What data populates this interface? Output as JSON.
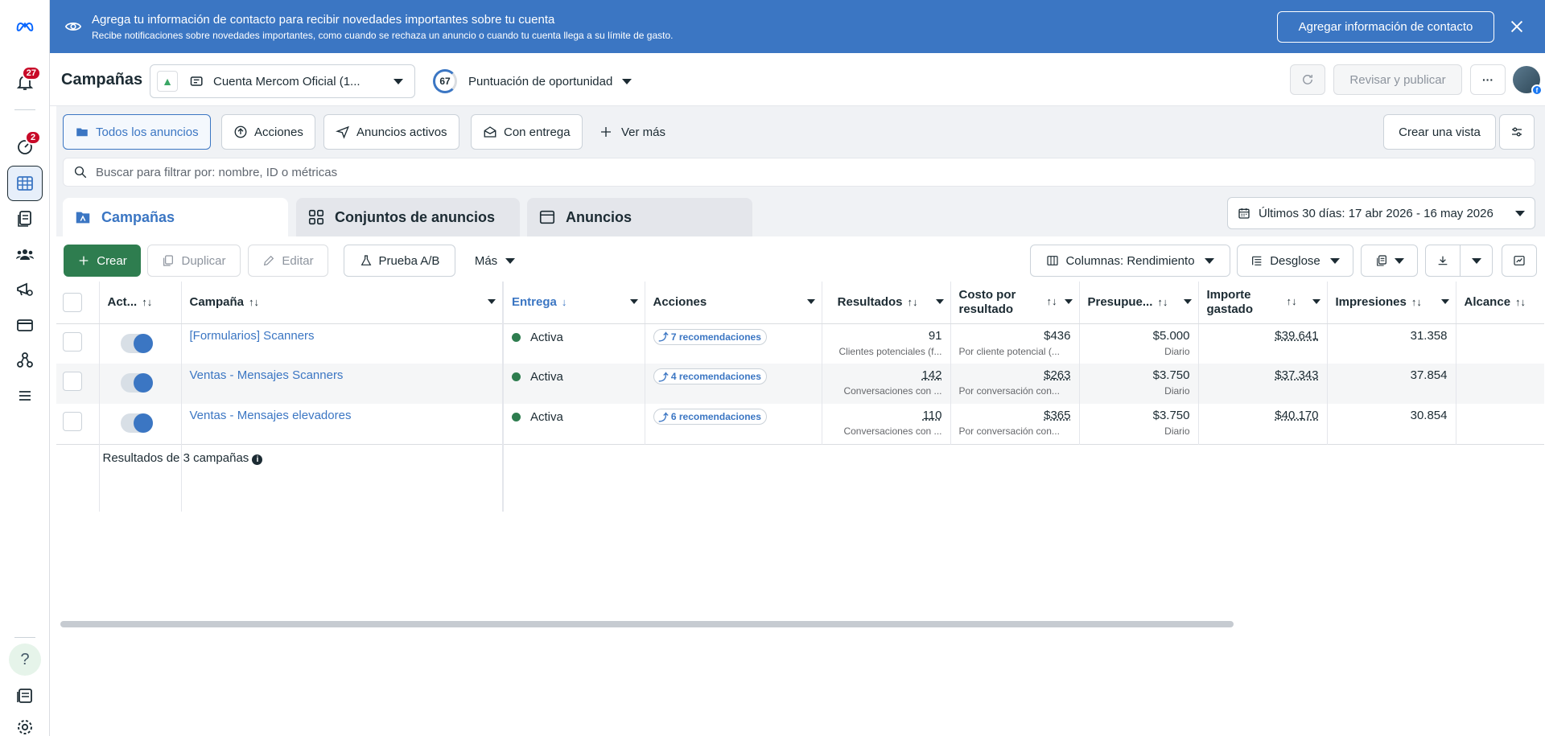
{
  "rail": {
    "notifications_badge": "27",
    "alerts_badge": "2"
  },
  "banner": {
    "title": "Agrega tu información de contacto para recibir novedades importantes sobre tu cuenta",
    "subtitle": "Recibe notificaciones sobre novedades importantes, como cuando se rechaza un anuncio o cuando tu cuenta llega a su límite de gasto.",
    "button_label": "Agregar información de contacto"
  },
  "header": {
    "title": "Campañas",
    "account_name": "Cuenta Mercom Oficial (1...",
    "opportunity_score": "67",
    "opportunity_label": "Puntuación de oportunidad",
    "review_label": "Revisar y publicar",
    "more_label": "···"
  },
  "filters": {
    "all_ads": "Todos los anuncios",
    "actions": "Acciones",
    "active_ads": "Anuncios activos",
    "with_delivery": "Con entrega",
    "see_more": "Ver más",
    "create_view": "Crear una vista"
  },
  "search": {
    "placeholder": "Buscar para filtrar por: nombre, ID o métricas"
  },
  "tabs": {
    "campaigns": "Campañas",
    "adsets": "Conjuntos de anuncios",
    "ads": "Anuncios"
  },
  "date_range": "Últimos 30 días: 17 abr 2026 - 16 may 2026",
  "toolbar": {
    "create": "Crear",
    "duplicate": "Duplicar",
    "edit": "Editar",
    "ab_test": "Prueba A/B",
    "more": "Más",
    "columns": "Columnas: Rendimiento",
    "breakdown": "Desglose"
  },
  "table": {
    "headers": {
      "active": "Act...",
      "campaign": "Campaña",
      "delivery": "Entrega",
      "actions": "Acciones",
      "results": "Resultados",
      "cost_per_result": "Costo por resultado",
      "budget": "Presupue...",
      "amount_spent": "Importe gastado",
      "impressions": "Impresiones",
      "reach": "Alcance"
    },
    "rows": [
      {
        "name": "[Formularios] Scanners",
        "delivery": "Activa",
        "recommendations": "7 recomendaciones",
        "results": "91",
        "results_sub": "Clientes potenciales (f...",
        "cost": "$436",
        "cost_sub": "Por cliente potencial (...",
        "budget": "$5.000",
        "budget_sub": "Diario",
        "spent": "$39.641",
        "impressions": "31.358"
      },
      {
        "name": "Ventas - Mensajes Scanners",
        "delivery": "Activa",
        "recommendations": "4 recomendaciones",
        "results": "142",
        "results_sub": "Conversaciones con ...",
        "cost": "$263",
        "cost_sub": "Por conversación con...",
        "budget": "$3.750",
        "budget_sub": "Diario",
        "spent": "$37.343",
        "impressions": "37.854"
      },
      {
        "name": "Ventas - Mensajes elevadores",
        "delivery": "Activa",
        "recommendations": "6 recomendaciones",
        "results": "110",
        "results_sub": "Conversaciones con ...",
        "cost": "$365",
        "cost_sub": "Por conversación con...",
        "budget": "$3.750",
        "budget_sub": "Diario",
        "spent": "$40.170",
        "impressions": "30.854"
      }
    ],
    "summary": "Resultados de 3 campañas"
  },
  "colors": {
    "banner": "#3b76c3",
    "accent": "#3b76c3",
    "create_button": "#2e7d4f",
    "badge": "#c80a28"
  }
}
